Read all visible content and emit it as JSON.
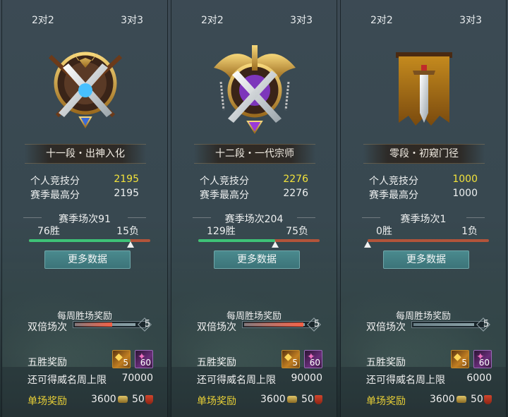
{
  "panels": [
    {
      "tabs": [
        "2对2",
        "3对3"
      ],
      "rank": "十一段・出神入化",
      "personal_label": "个人竞技分",
      "personal_value": "2195",
      "season_high_label": "赛季最高分",
      "season_high_value": "2195",
      "season_matches": "赛季场次91",
      "wins": "76胜",
      "losses": "15负",
      "win_ratio": 0.835,
      "more_button": "更多数据",
      "weekly_title": "每周胜场奖励",
      "double_label": "双倍场次",
      "double_count": "5",
      "double_progress": 0.6,
      "five_win_label": "五胜奖励",
      "items": [
        {
          "count": "5",
          "icon": "gold-token-icon"
        },
        {
          "count": "60",
          "icon": "purple-gem-icon"
        }
      ],
      "fame_label": "还可得威名周上限",
      "fame_value": "70000",
      "single_label": "单场奖励",
      "single_coin": "3600",
      "single_points": "50"
    },
    {
      "tabs": [
        "2对2",
        "3对3"
      ],
      "rank": "十二段・一代宗师",
      "personal_label": "个人竞技分",
      "personal_value": "2276",
      "season_high_label": "赛季最高分",
      "season_high_value": "2276",
      "season_matches": "赛季场次204",
      "wins": "129胜",
      "losses": "75负",
      "win_ratio": 0.632,
      "more_button": "更多数据",
      "weekly_title": "每周胜场奖励",
      "double_label": "双倍场次",
      "double_count": "5",
      "double_progress": 0.95,
      "five_win_label": "五胜奖励",
      "items": [
        {
          "count": "5",
          "icon": "gold-token-icon"
        },
        {
          "count": "60",
          "icon": "purple-gem-icon"
        }
      ],
      "fame_label": "还可得威名周上限",
      "fame_value": "90000",
      "single_label": "单场奖励",
      "single_coin": "3600",
      "single_points": "50"
    },
    {
      "tabs": [
        "2对2",
        "3对3"
      ],
      "rank": "零段・初窥门径",
      "personal_label": "个人竞技分",
      "personal_value": "1000",
      "season_high_label": "赛季最高分",
      "season_high_value": "1000",
      "season_matches": "赛季场次1",
      "wins": "0胜",
      "losses": "1负",
      "win_ratio": 0.0,
      "more_button": "更多数据",
      "weekly_title": "每周胜场奖励",
      "double_label": "双倍场次",
      "double_count": "5",
      "double_progress": 0.0,
      "five_win_label": "五胜奖励",
      "items": [
        {
          "count": "5",
          "icon": "gold-token-icon"
        },
        {
          "count": "60",
          "icon": "purple-gem-icon"
        }
      ],
      "fame_label": "还可得威名周上限",
      "fame_value": "6000",
      "single_label": "单场奖励",
      "single_coin": "3600",
      "single_points": "50"
    }
  ],
  "colors": {
    "score_highlight": "#f2e23a",
    "win_bar": "#3ec277",
    "loss_bar": "#b3543a",
    "single_label": "#e9d036",
    "button": "#3c7479"
  }
}
